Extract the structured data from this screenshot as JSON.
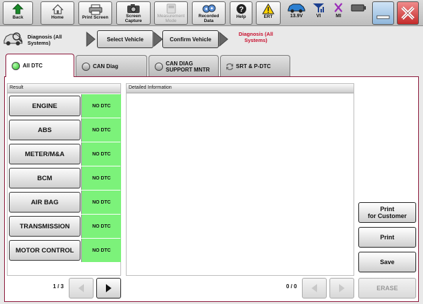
{
  "toolbar": {
    "back": "Back",
    "home": "Home",
    "print_screen": "Print Screen",
    "screen_capture": "Screen\nCapture",
    "measurement_mode": "Measurement\nMode",
    "recorded_data": "Recorded\nData",
    "help": "Help",
    "ert": "ERT",
    "voltage": "13.9V",
    "vi": "VI",
    "mi": "MI"
  },
  "breadcrumb": {
    "root": "Diagnosis (All\nSystems)",
    "step1": "Select Vehicle",
    "step2": "Confirm Vehicle",
    "current": "Diagnosis (All\nSystems)"
  },
  "tabs": [
    {
      "label": "All DTC"
    },
    {
      "label": "CAN Diag"
    },
    {
      "label": "CAN DIAG\nSUPPORT MNTR"
    },
    {
      "label": "SRT & P-DTC"
    }
  ],
  "results": {
    "header": "Result",
    "rows": [
      {
        "system": "ENGINE",
        "status": "NO DTC"
      },
      {
        "system": "ABS",
        "status": "NO DTC"
      },
      {
        "system": "METER/M&A",
        "status": "NO DTC"
      },
      {
        "system": "BCM",
        "status": "NO DTC"
      },
      {
        "system": "AIR BAG",
        "status": "NO DTC"
      },
      {
        "system": "TRANSMISSION",
        "status": "NO DTC"
      },
      {
        "system": "MOTOR CONTROL",
        "status": "NO DTC"
      }
    ],
    "page": "1 / 3"
  },
  "detail": {
    "header": "Detailed Information",
    "page": "0 / 0"
  },
  "side_buttons": {
    "print_customer": "Print\nfor Customer",
    "print": "Print",
    "save": "Save",
    "erase": "ERASE"
  },
  "colors": {
    "accent": "#8a1538",
    "no_dtc_green": "#7cf27a",
    "current_step": "#c8102e"
  }
}
